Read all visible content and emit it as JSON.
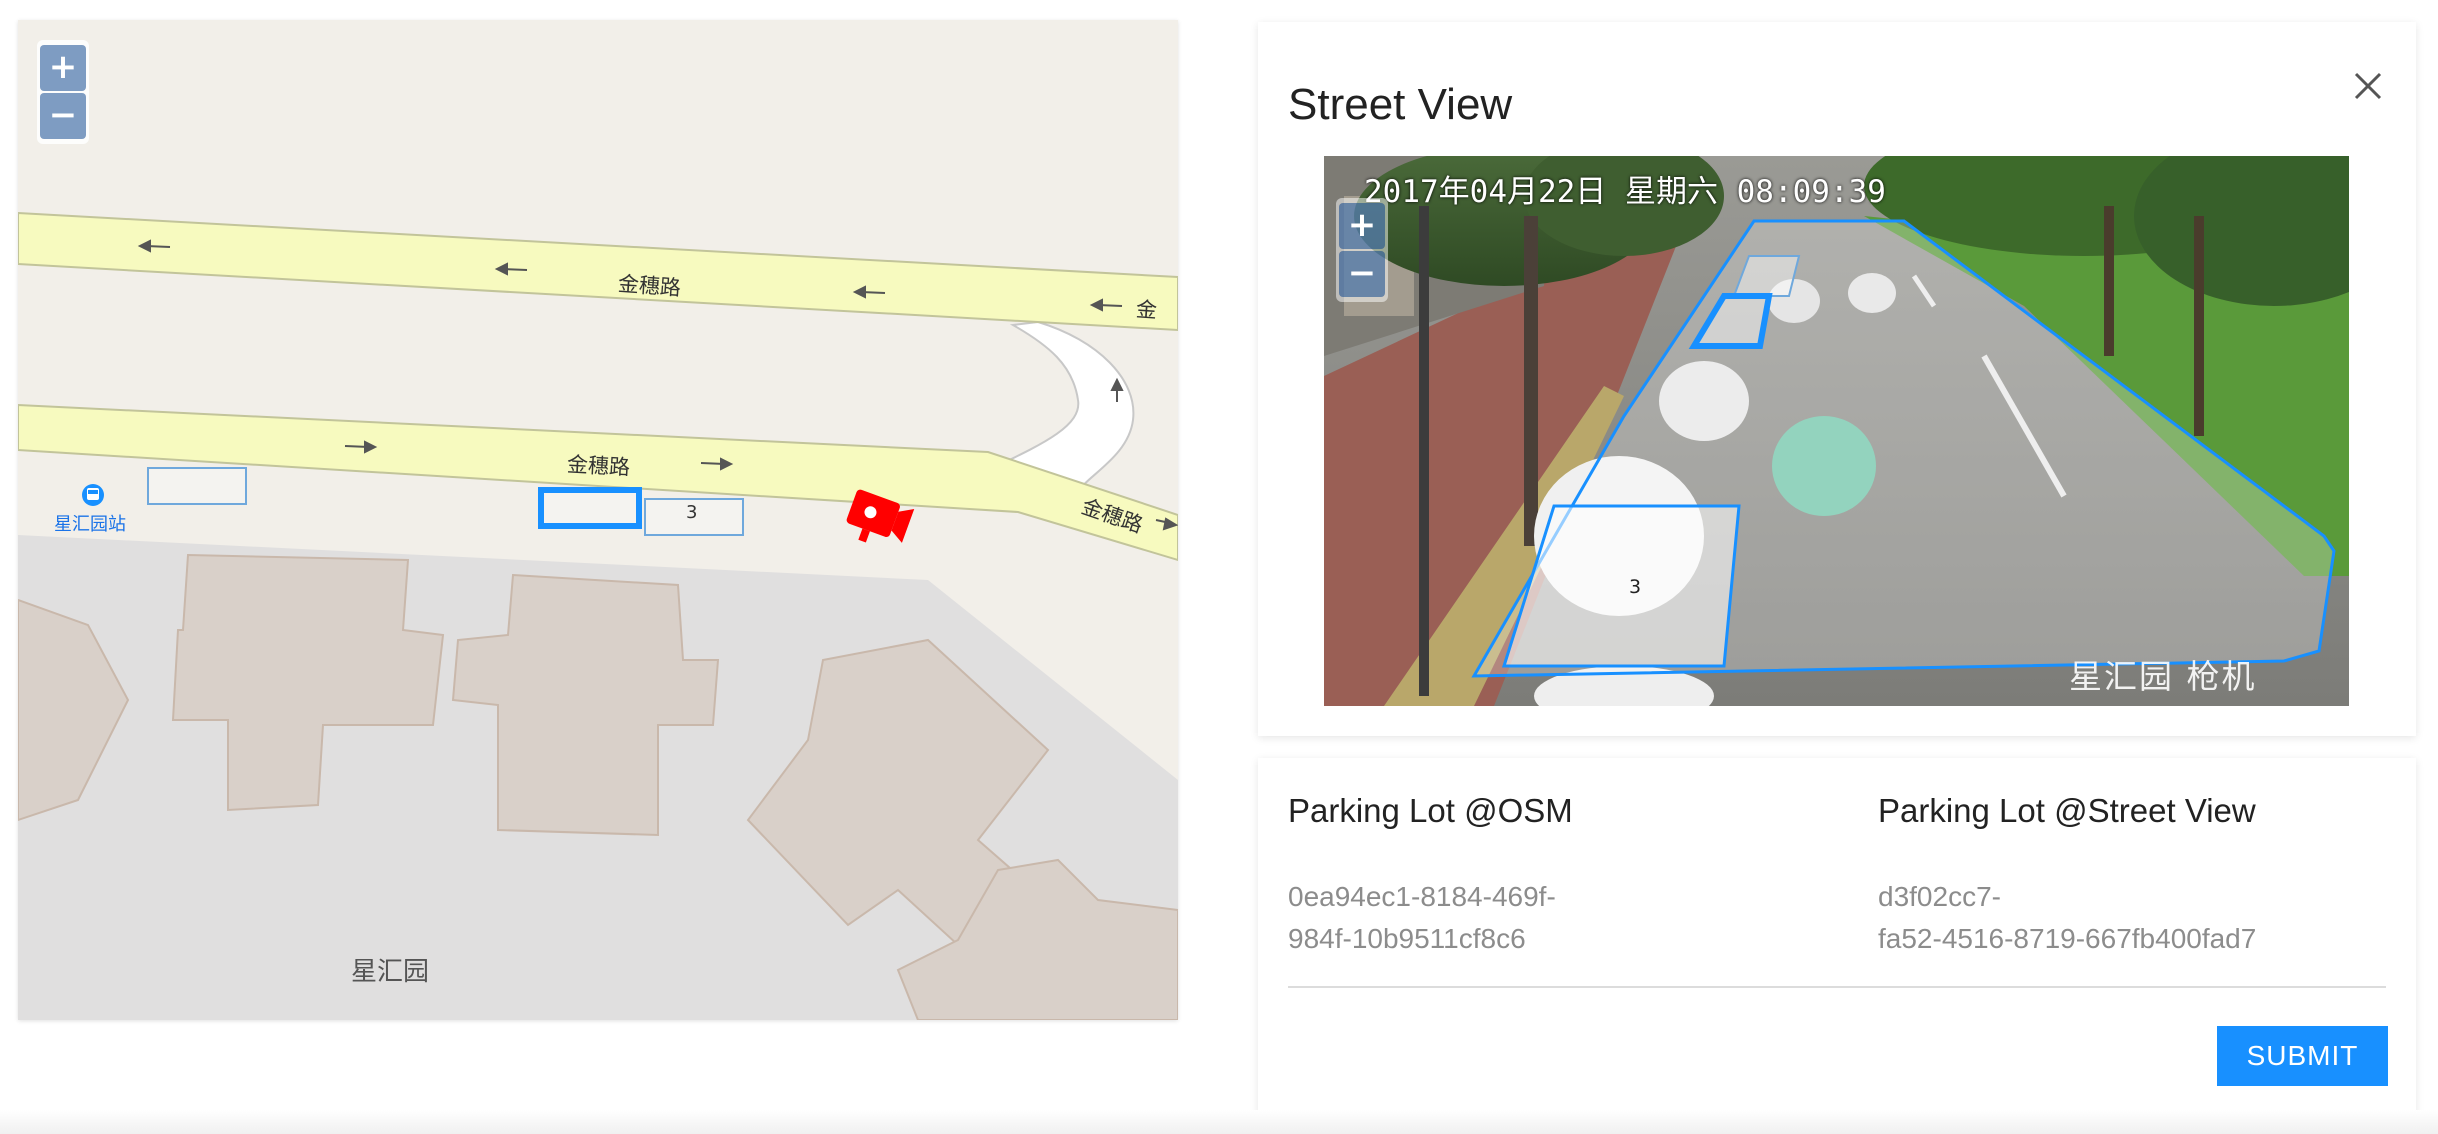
{
  "map": {
    "zoom_in_label": "+",
    "zoom_out_label": "−",
    "road_name": "金穗路",
    "road_name_partial": "金",
    "bus_stop_label": "星汇园站",
    "area_label": "星汇园",
    "parking_lot_number": "3",
    "colors": {
      "road": "#f7fabf",
      "building": "#d9d0c9",
      "camera": "#ff0000",
      "selected": "#1890ff"
    }
  },
  "street_view": {
    "title": "Street View",
    "close_icon": "close-icon",
    "zoom_in_label": "+",
    "zoom_out_label": "−",
    "timestamp": "2017年04月22日 星期六 08:09:39",
    "camera_caption": "星汇园 枪机",
    "parking_lot_number": "3"
  },
  "parking_lot": {
    "osm_label": "Parking Lot @OSM",
    "osm_id_line1": "0ea94ec1-8184-469f-",
    "osm_id_line2": "984f-10b9511cf8c6",
    "sv_label": "Parking Lot @Street View",
    "sv_id_line1": "d3f02cc7-",
    "sv_id_line2": "fa52-4516-8719-667fb400fad7",
    "submit_label": "SUBMIT"
  }
}
